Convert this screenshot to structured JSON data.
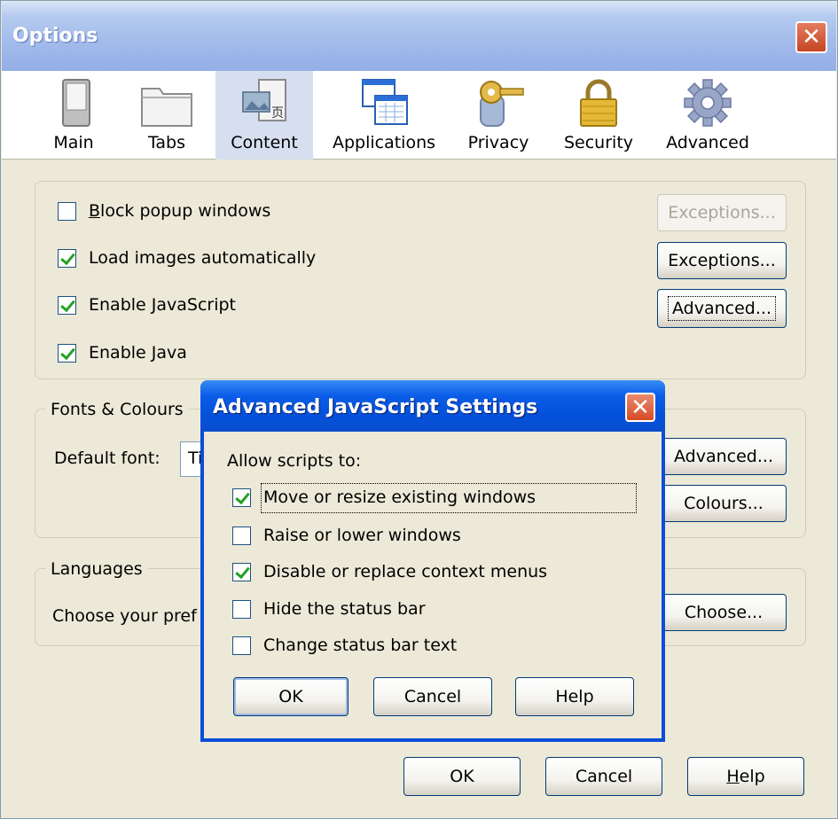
{
  "window": {
    "title": "Options"
  },
  "toolbar": {
    "items": [
      {
        "label": "Main"
      },
      {
        "label": "Tabs"
      },
      {
        "label": "Content"
      },
      {
        "label": "Applications"
      },
      {
        "label": "Privacy"
      },
      {
        "label": "Security"
      },
      {
        "label": "Advanced"
      }
    ],
    "selected": "Content"
  },
  "content": {
    "options": [
      {
        "label": "Block popup windows",
        "checked": false,
        "button": "Exceptions...",
        "button_enabled": false
      },
      {
        "label": "Load images automatically",
        "checked": true,
        "button": "Exceptions...",
        "button_enabled": true
      },
      {
        "label": "Enable JavaScript",
        "checked": true,
        "button": "Advanced...",
        "button_enabled": true
      },
      {
        "label": "Enable Java",
        "checked": true
      }
    ]
  },
  "fonts": {
    "legend": "Fonts & Colours",
    "default_font_label": "Default font:",
    "default_font_value": "Ti",
    "advanced_button": "Advanced...",
    "colours_button": "Colours..."
  },
  "languages": {
    "legend": "Languages",
    "description": "Choose your pref",
    "choose_button": "Choose..."
  },
  "footer": {
    "ok": "OK",
    "cancel": "Cancel",
    "help": "Help"
  },
  "dialog": {
    "title": "Advanced JavaScript Settings",
    "allow_label": "Allow scripts to:",
    "options": [
      {
        "label": "Move or resize existing windows",
        "checked": true
      },
      {
        "label": "Raise or lower windows",
        "checked": false
      },
      {
        "label": "Disable or replace context menus",
        "checked": true
      },
      {
        "label": "Hide the status bar",
        "checked": false
      },
      {
        "label": "Change status bar text",
        "checked": false
      }
    ],
    "ok": "OK",
    "cancel": "Cancel",
    "help": "Help"
  },
  "colors": {
    "window_bg": "#ece9d8",
    "dialog_title_blue": "#0450d9",
    "close_red": "#d54a24",
    "check_green": "#21a121"
  }
}
